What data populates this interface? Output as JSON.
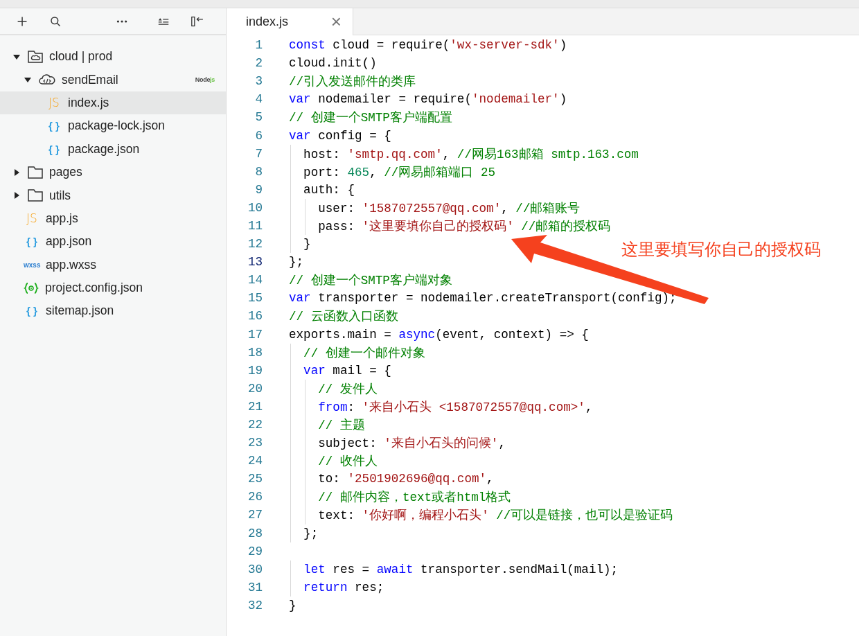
{
  "sidebar": {
    "toolbar": [
      {
        "kind": "add"
      },
      {
        "kind": "search"
      },
      {
        "kind": "more"
      },
      {
        "kind": "collapse"
      },
      {
        "kind": "split"
      }
    ],
    "tree": [
      {
        "name": "cloud | prod",
        "kind": "cloud-folder",
        "expanded": true,
        "selected": false,
        "children": [
          {
            "name": "sendEmail",
            "kind": "cloud-function",
            "expanded": true,
            "selected": false,
            "badge": [
              "Node",
              "js"
            ],
            "children": [
              {
                "name": "index.js",
                "kind": "js",
                "glyph": "JS",
                "selected": true
              },
              {
                "name": "package-lock.json",
                "kind": "json",
                "glyph": "{ }",
                "selected": false
              },
              {
                "name": "package.json",
                "kind": "json",
                "glyph": "{ }",
                "selected": false
              }
            ]
          }
        ]
      },
      {
        "name": "pages",
        "kind": "folder",
        "expanded": false,
        "selected": false
      },
      {
        "name": "utils",
        "kind": "folder",
        "expanded": false,
        "selected": false
      },
      {
        "name": "app.js",
        "kind": "js",
        "glyph": "JS",
        "selected": false
      },
      {
        "name": "app.json",
        "kind": "json",
        "glyph": "{ }",
        "selected": false
      },
      {
        "name": "app.wxss",
        "kind": "wxss",
        "glyph": "wxss",
        "selected": false
      },
      {
        "name": "project.config.json",
        "kind": "config",
        "selected": false
      },
      {
        "name": "sitemap.json",
        "kind": "json",
        "glyph": "{ }",
        "selected": false
      }
    ]
  },
  "editor": {
    "tabs": [
      {
        "label": "index.js",
        "selected": true,
        "close": "×"
      }
    ],
    "lines": [
      {
        "number": "1",
        "current": false,
        "tokens": [
          {
            "kind": "kw",
            "s": "const"
          },
          {
            "kind": "plain",
            "s": " cloud = require("
          },
          {
            "kind": "str",
            "s": "'wx-server-sdk'"
          },
          {
            "kind": "plain",
            "s": ")"
          }
        ]
      },
      {
        "number": "2",
        "current": false,
        "tokens": [
          {
            "kind": "plain",
            "s": "cloud.init()"
          }
        ]
      },
      {
        "number": "3",
        "current": false,
        "tokens": [
          {
            "kind": "com",
            "s": "//引入发送邮件的类库"
          }
        ]
      },
      {
        "number": "4",
        "current": false,
        "tokens": [
          {
            "kind": "kw",
            "s": "var"
          },
          {
            "kind": "plain",
            "s": " nodemailer = require("
          },
          {
            "kind": "str",
            "s": "'nodemailer'"
          },
          {
            "kind": "plain",
            "s": ")"
          }
        ]
      },
      {
        "number": "5",
        "current": false,
        "tokens": [
          {
            "kind": "com",
            "s": "// 创建一个SMTP客户端配置"
          }
        ]
      },
      {
        "number": "6",
        "current": false,
        "tokens": [
          {
            "kind": "kw",
            "s": "var"
          },
          {
            "kind": "plain",
            "s": " config = {"
          }
        ]
      },
      {
        "number": "7",
        "current": false,
        "tokens": [
          {
            "kind": "plain",
            "s": "  host: "
          },
          {
            "kind": "str",
            "s": "'smtp.qq.com'"
          },
          {
            "kind": "plain",
            "s": ", "
          },
          {
            "kind": "com",
            "s": "//网易163邮箱 smtp.163.com"
          }
        ]
      },
      {
        "number": "8",
        "current": false,
        "tokens": [
          {
            "kind": "plain",
            "s": "  port: "
          },
          {
            "kind": "num",
            "s": "465"
          },
          {
            "kind": "plain",
            "s": ", "
          },
          {
            "kind": "com",
            "s": "//网易邮箱端口 25"
          }
        ]
      },
      {
        "number": "9",
        "current": false,
        "tokens": [
          {
            "kind": "plain",
            "s": "  auth: {"
          }
        ]
      },
      {
        "number": "10",
        "current": false,
        "tokens": [
          {
            "kind": "plain",
            "s": "    user: "
          },
          {
            "kind": "str",
            "s": "'1587072557@qq.com'"
          },
          {
            "kind": "plain",
            "s": ", "
          },
          {
            "kind": "com",
            "s": "//邮箱账号"
          }
        ]
      },
      {
        "number": "11",
        "current": false,
        "tokens": [
          {
            "kind": "plain",
            "s": "    pass: "
          },
          {
            "kind": "str",
            "s": "'这里要填你自己的授权码'"
          },
          {
            "kind": "com",
            "s": " //邮箱的授权码"
          }
        ]
      },
      {
        "number": "12",
        "current": false,
        "tokens": [
          {
            "kind": "plain",
            "s": "  }"
          }
        ]
      },
      {
        "number": "13",
        "current": true,
        "tokens": [
          {
            "kind": "plain",
            "s": "};"
          }
        ]
      },
      {
        "number": "14",
        "current": false,
        "tokens": [
          {
            "kind": "com",
            "s": "// 创建一个SMTP客户端对象"
          }
        ]
      },
      {
        "number": "15",
        "current": false,
        "tokens": [
          {
            "kind": "kw",
            "s": "var"
          },
          {
            "kind": "plain",
            "s": " transporter = nodemailer.createTransport(config);"
          }
        ]
      },
      {
        "number": "16",
        "current": false,
        "tokens": [
          {
            "kind": "com",
            "s": "// 云函数入口函数"
          }
        ]
      },
      {
        "number": "17",
        "current": false,
        "tokens": [
          {
            "kind": "plain",
            "s": "exports.main = "
          },
          {
            "kind": "kw",
            "s": "async"
          },
          {
            "kind": "plain",
            "s": "(event, context) => {"
          }
        ]
      },
      {
        "number": "18",
        "current": false,
        "tokens": [
          {
            "kind": "com",
            "s": "  // 创建一个邮件对象"
          }
        ]
      },
      {
        "number": "19",
        "current": false,
        "tokens": [
          {
            "kind": "kw",
            "s": "  var"
          },
          {
            "kind": "plain",
            "s": " mail = {"
          }
        ]
      },
      {
        "number": "20",
        "current": false,
        "tokens": [
          {
            "kind": "com",
            "s": "    // 发件人"
          }
        ]
      },
      {
        "number": "21",
        "current": false,
        "tokens": [
          {
            "kind": "kw",
            "s": "    from"
          },
          {
            "kind": "plain",
            "s": ": "
          },
          {
            "kind": "str",
            "s": "'来自小石头 <1587072557@qq.com>'"
          },
          {
            "kind": "plain",
            "s": ","
          }
        ]
      },
      {
        "number": "22",
        "current": false,
        "tokens": [
          {
            "kind": "com",
            "s": "    // 主题"
          }
        ]
      },
      {
        "number": "23",
        "current": false,
        "tokens": [
          {
            "kind": "plain",
            "s": "    subject: "
          },
          {
            "kind": "str",
            "s": "'来自小石头的问候'"
          },
          {
            "kind": "plain",
            "s": ","
          }
        ]
      },
      {
        "number": "24",
        "current": false,
        "tokens": [
          {
            "kind": "com",
            "s": "    // 收件人"
          }
        ]
      },
      {
        "number": "25",
        "current": false,
        "tokens": [
          {
            "kind": "plain",
            "s": "    to: "
          },
          {
            "kind": "str",
            "s": "'2501902696@qq.com'"
          },
          {
            "kind": "plain",
            "s": ","
          }
        ]
      },
      {
        "number": "26",
        "current": false,
        "tokens": [
          {
            "kind": "com",
            "s": "    // 邮件内容，text或者html格式"
          }
        ]
      },
      {
        "number": "27",
        "current": false,
        "tokens": [
          {
            "kind": "plain",
            "s": "    text: "
          },
          {
            "kind": "str",
            "s": "'你好啊，编程小石头'"
          },
          {
            "kind": "com",
            "s": " //可以是链接，也可以是验证码"
          }
        ]
      },
      {
        "number": "28",
        "current": false,
        "tokens": [
          {
            "kind": "plain",
            "s": "  };"
          }
        ]
      },
      {
        "number": "29",
        "current": false
      },
      {
        "number": "30",
        "current": false,
        "tokens": [
          {
            "kind": "kw",
            "s": "  let"
          },
          {
            "kind": "plain",
            "s": " res = "
          },
          {
            "kind": "kw",
            "s": "await"
          },
          {
            "kind": "plain",
            "s": " transporter.sendMail(mail);"
          }
        ]
      },
      {
        "number": "31",
        "current": false,
        "tokens": [
          {
            "kind": "kw",
            "s": "  return"
          },
          {
            "kind": "plain",
            "s": " res;"
          }
        ]
      },
      {
        "number": "32",
        "current": false,
        "tokens": [
          {
            "kind": "plain",
            "s": "}"
          }
        ]
      }
    ]
  },
  "annotation": {
    "label": "这里要填写你自己的授权码"
  }
}
